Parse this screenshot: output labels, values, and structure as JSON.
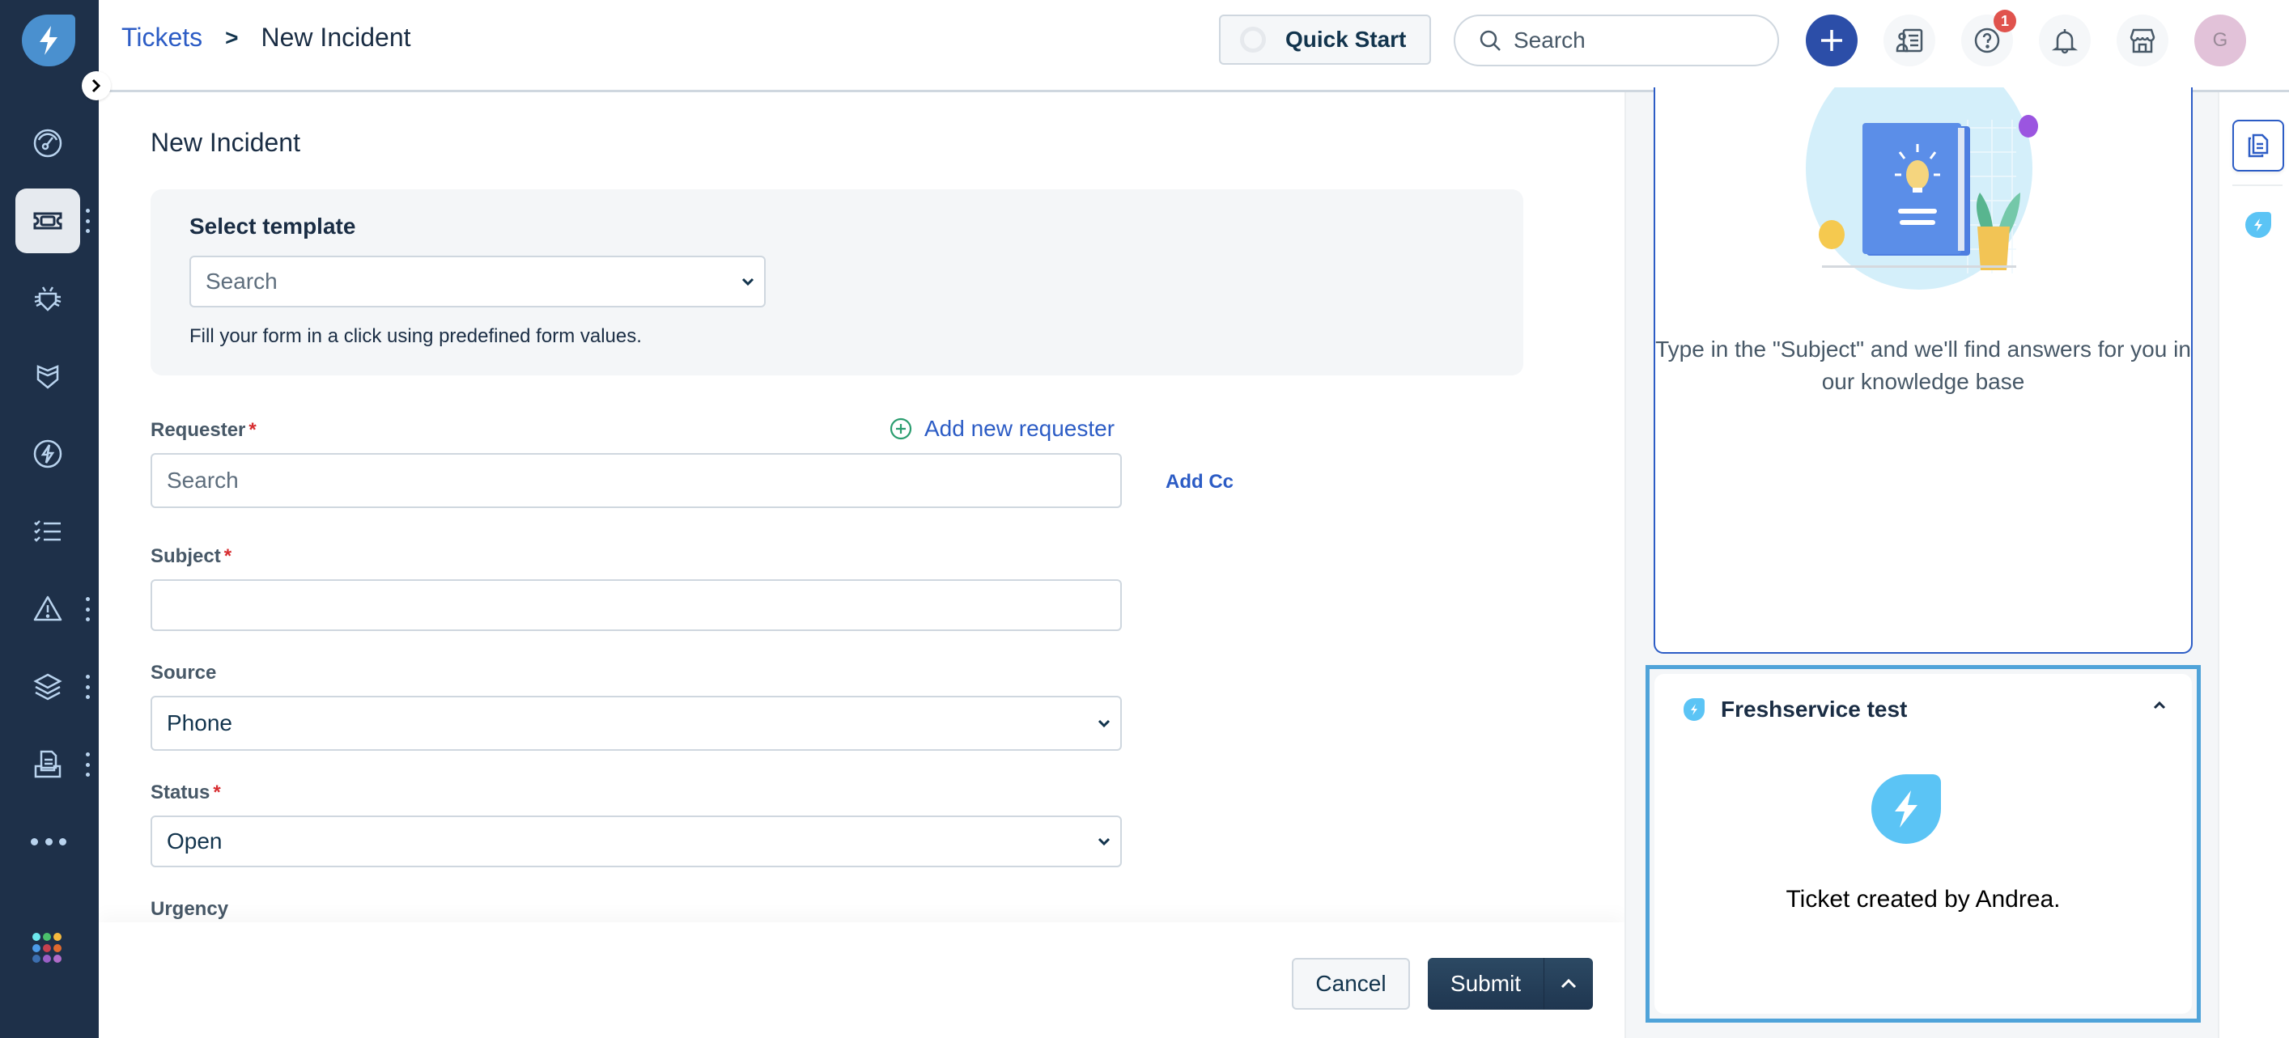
{
  "app": {
    "name": "Freshservice"
  },
  "sidebar": {
    "items": [
      {
        "name": "dashboard",
        "icon": "gauge-icon",
        "active": false,
        "has_more": false
      },
      {
        "name": "tickets",
        "icon": "ticket-icon",
        "active": true,
        "has_more": true
      },
      {
        "name": "problems",
        "icon": "bug-icon",
        "active": false,
        "has_more": false
      },
      {
        "name": "changes",
        "icon": "shield-icon",
        "active": false,
        "has_more": false
      },
      {
        "name": "releases",
        "icon": "bolt-circle-icon",
        "active": false,
        "has_more": false
      },
      {
        "name": "tasks",
        "icon": "checklist-icon",
        "active": false,
        "has_more": false
      },
      {
        "name": "alerts",
        "icon": "warning-icon",
        "active": false,
        "has_more": true
      },
      {
        "name": "assets",
        "icon": "layers-icon",
        "active": false,
        "has_more": true
      },
      {
        "name": "solutions",
        "icon": "document-tray-icon",
        "active": false,
        "has_more": true
      }
    ],
    "apps_grid_colors": [
      "#6ee8ef",
      "#4bbf6b",
      "#f5b93e",
      "#4c9be8",
      "#c6414f",
      "#e06a2f",
      "#3c6fb0",
      "#9a5fc6",
      "#b06cc9"
    ]
  },
  "header": {
    "breadcrumb": {
      "parent": "Tickets",
      "separator": ">",
      "current": "New Incident"
    },
    "quick_start_label": "Quick Start",
    "search_placeholder": "Search",
    "help_badge_count": "1",
    "avatar_initial": "G"
  },
  "form": {
    "title": "New Incident",
    "template": {
      "label": "Select template",
      "placeholder": "Search",
      "help": "Fill your form in a click using predefined form values."
    },
    "requester": {
      "label": "Requester",
      "required": "*",
      "placeholder": "Search",
      "add_new_label": "Add new requester",
      "add_cc_label": "Add Cc"
    },
    "subject": {
      "label": "Subject",
      "required": "*",
      "value": ""
    },
    "source": {
      "label": "Source",
      "value": "Phone"
    },
    "status": {
      "label": "Status",
      "required": "*",
      "value": "Open"
    },
    "urgency": {
      "label": "Urgency"
    },
    "actions": {
      "cancel_label": "Cancel",
      "submit_label": "Submit"
    }
  },
  "right_panel": {
    "kb_message": "Type in the \"Subject\" and we'll find answers for you in our knowledge base",
    "app_widget": {
      "title": "Freshservice test",
      "message": "Ticket created by Andrea."
    }
  },
  "colors": {
    "brand_dark": "#1e3049",
    "accent_blue": "#2c5cc5",
    "widget_border": "#4fa3d9",
    "app_logo": "#5bc4f5",
    "required": "#d72d30"
  }
}
